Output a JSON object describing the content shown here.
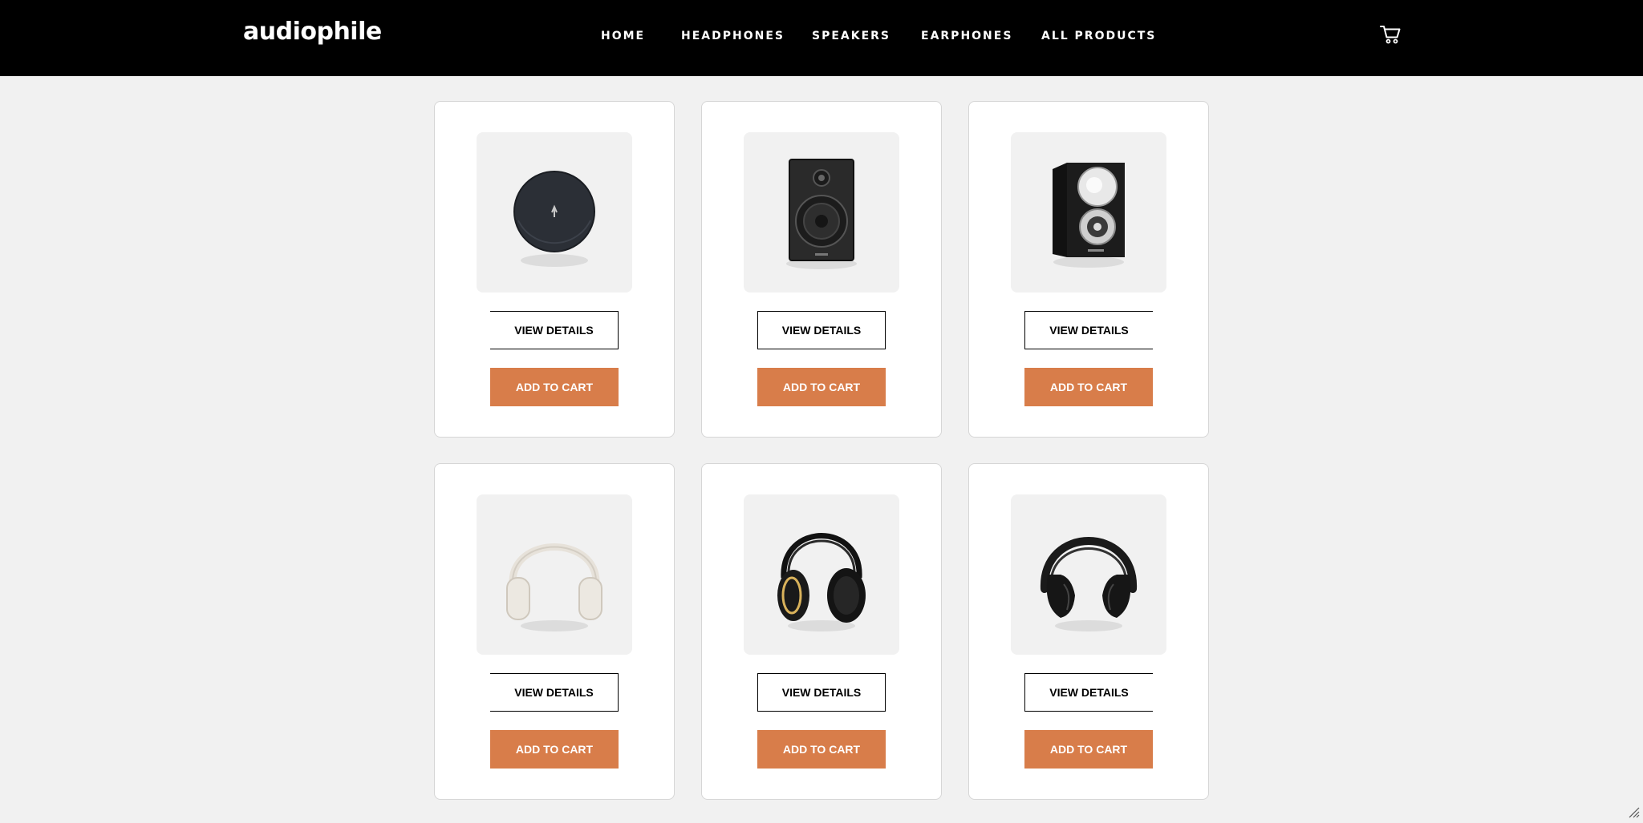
{
  "brand": {
    "logo_text": "audiophile"
  },
  "nav": {
    "links": [
      "HOME",
      "HEADPHONES",
      "SPEAKERS",
      "EARPHONES",
      "ALL PRODUCTS"
    ],
    "cart_icon": "cart-icon"
  },
  "colors": {
    "header_bg": "#000000",
    "page_bg": "#f1f1f1",
    "accent": "#d87d4a"
  },
  "products": [
    {
      "image": "earphones-case-image",
      "view_label": "VIEW DETAILS",
      "cart_label": "ADD TO CART"
    },
    {
      "image": "bookshelf-speaker-image",
      "view_label": "VIEW DETAILS",
      "cart_label": "ADD TO CART"
    },
    {
      "image": "tweeter-speaker-image",
      "view_label": "VIEW DETAILS",
      "cart_label": "ADD TO CART"
    },
    {
      "image": "white-headphones-image",
      "view_label": "VIEW DETAILS",
      "cart_label": "ADD TO CART"
    },
    {
      "image": "studio-headphones-image",
      "view_label": "VIEW DETAILS",
      "cart_label": "ADD TO CART"
    },
    {
      "image": "black-headphones-image",
      "view_label": "VIEW DETAILS",
      "cart_label": "ADD TO CART"
    }
  ]
}
